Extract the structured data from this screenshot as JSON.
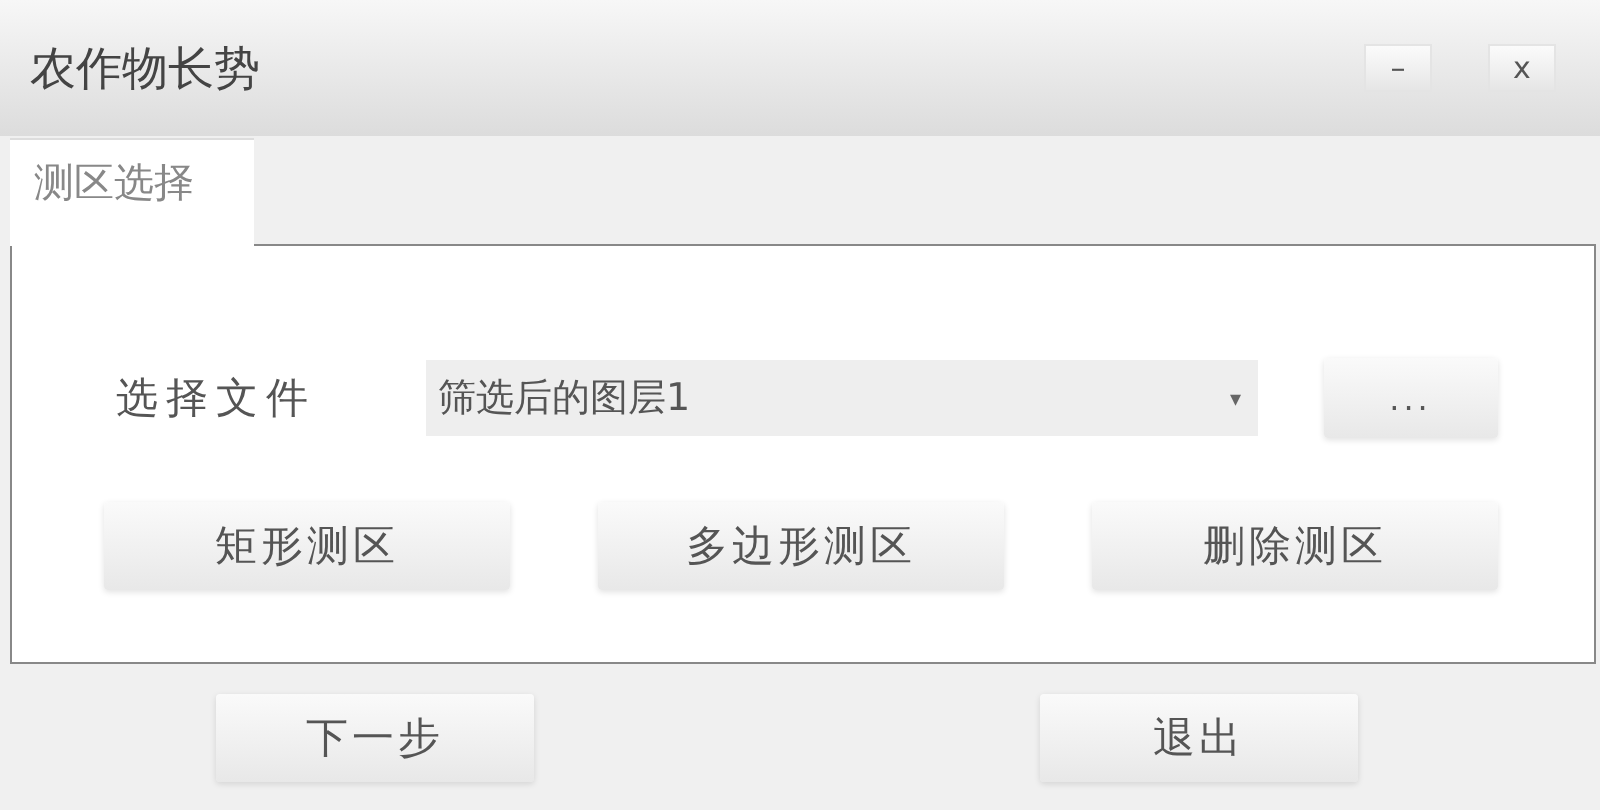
{
  "window": {
    "title": "农作物长势",
    "controls": [
      "–",
      "x"
    ]
  },
  "tabs": [
    {
      "label": "测区选择",
      "selected": true
    }
  ],
  "file_row": {
    "label": "选择文件",
    "dropdown": {
      "value": "筛选后的图层1",
      "arrow": "▾"
    },
    "browse_button": "..."
  },
  "area_buttons": [
    "矩形测区",
    "多边形测区",
    "删除测区"
  ],
  "footer_buttons": [
    "下一步",
    "退出"
  ]
}
